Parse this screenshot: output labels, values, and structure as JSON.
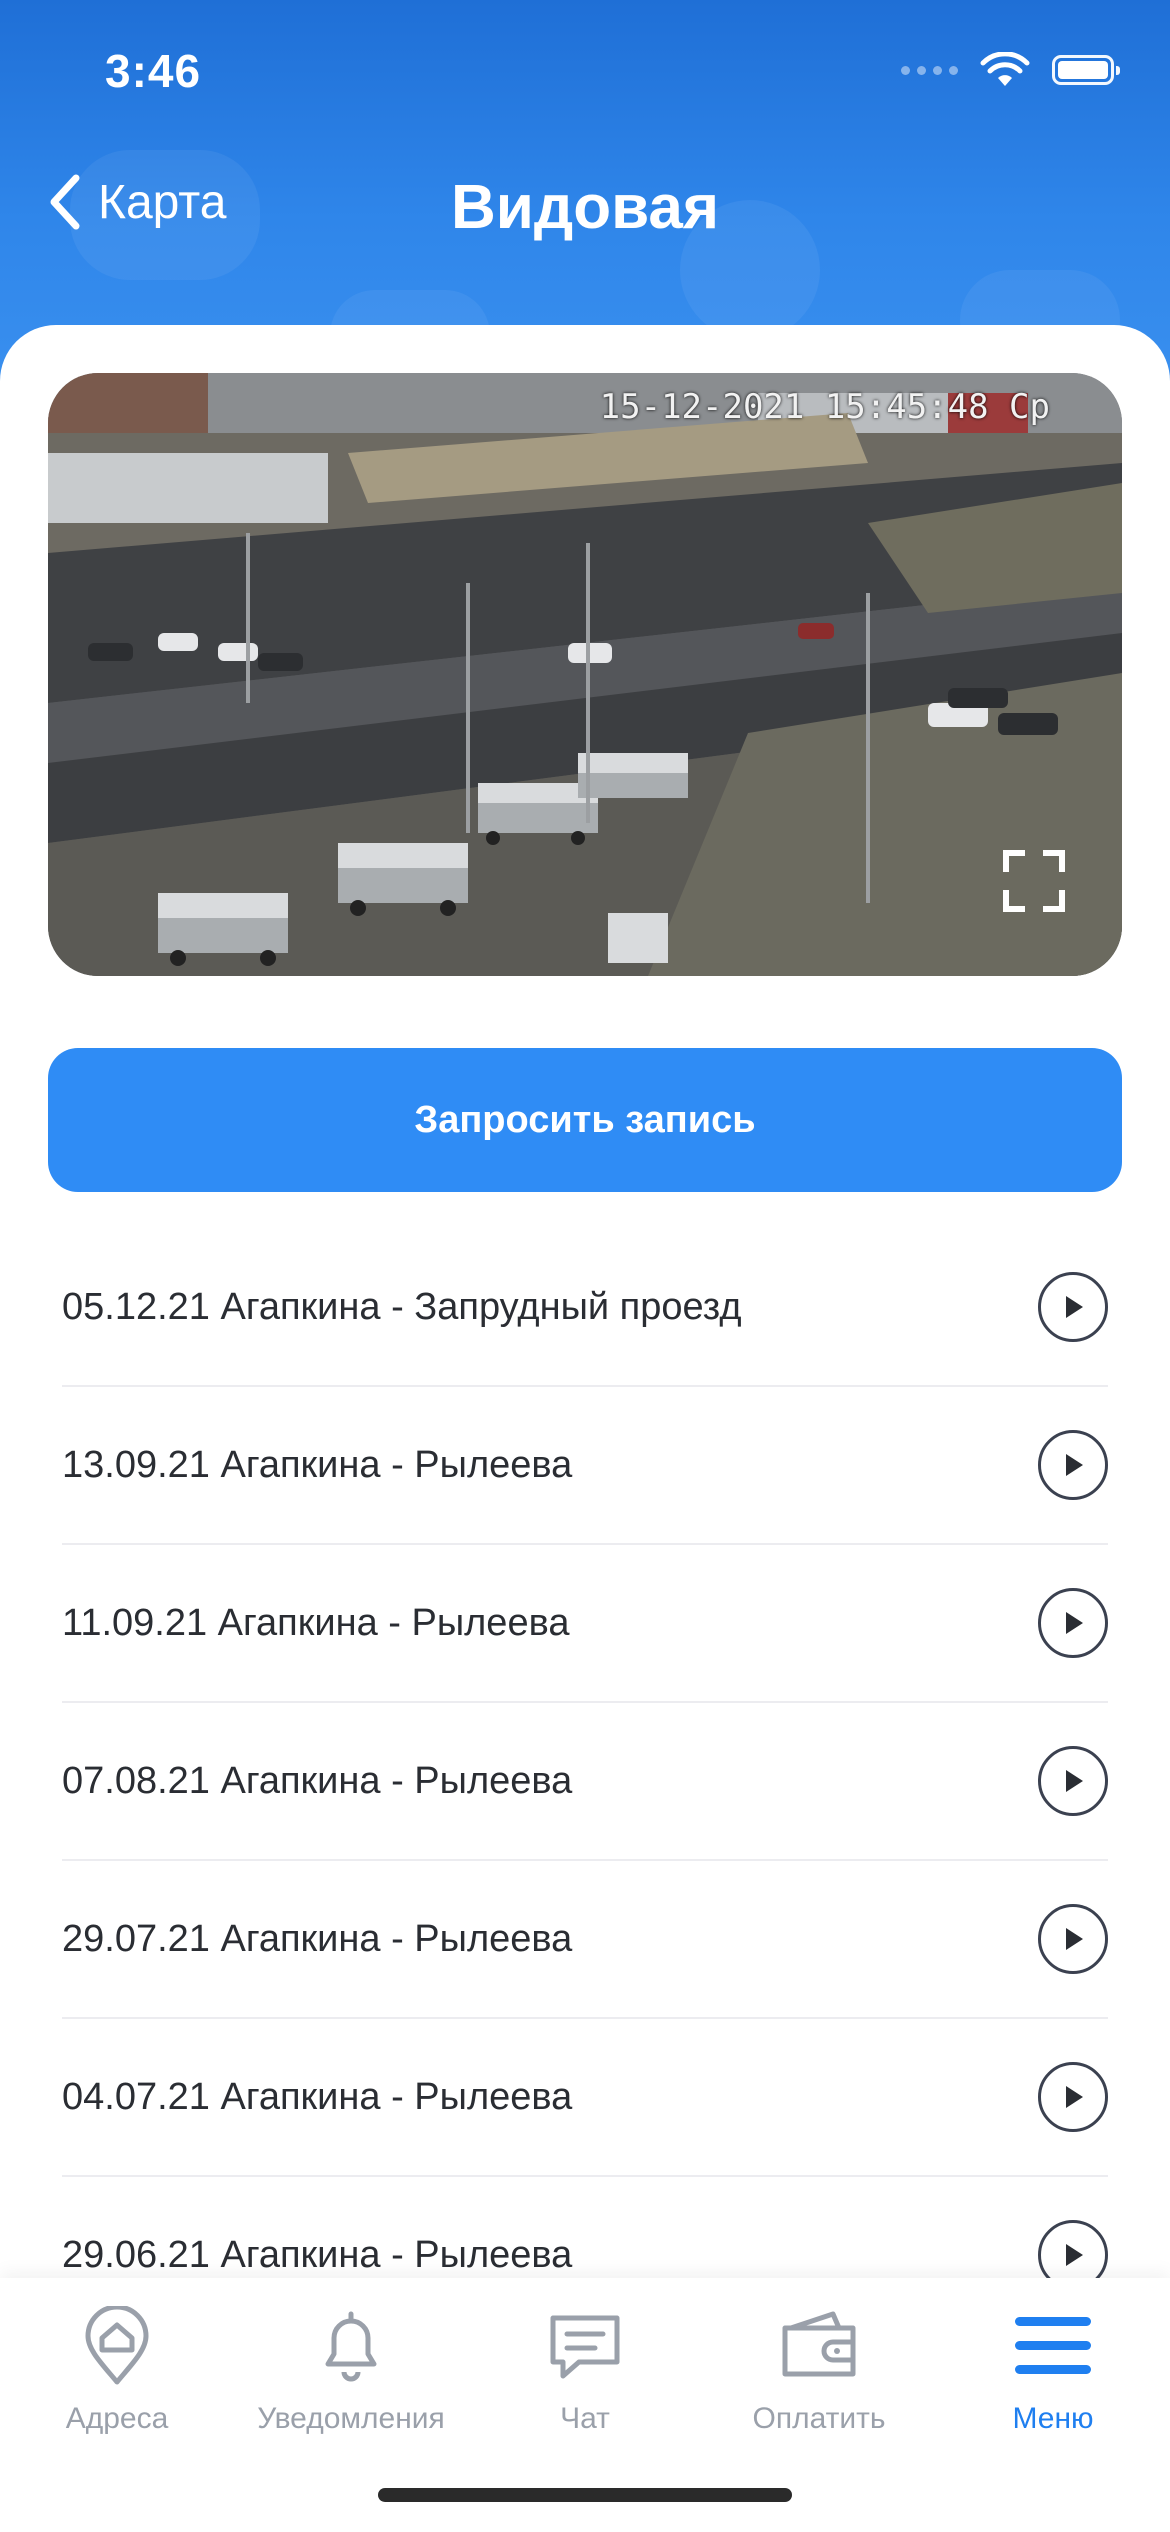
{
  "status_bar": {
    "time": "3:46"
  },
  "header": {
    "back_label": "Карта",
    "title": "Видовая"
  },
  "camera": {
    "timestamp": "15-12-2021 15:45:48 Ср"
  },
  "request_button": {
    "label": "Запросить запись"
  },
  "recordings": [
    {
      "label": "05.12.21 Агапкина - Запрудный проезд"
    },
    {
      "label": "13.09.21 Агапкина - Рылеева"
    },
    {
      "label": "11.09.21 Агапкина - Рылеева"
    },
    {
      "label": "07.08.21 Агапкина - Рылеева"
    },
    {
      "label": "29.07.21 Агапкина - Рылеева"
    },
    {
      "label": "04.07.21 Агапкина - Рылеева"
    },
    {
      "label": "29.06.21 Агапкина - Рылеева"
    }
  ],
  "tabbar": {
    "items": [
      {
        "label": "Адреса",
        "icon": "address-pin-icon",
        "active": false
      },
      {
        "label": "Уведомления",
        "icon": "bell-icon",
        "active": false
      },
      {
        "label": "Чат",
        "icon": "chat-icon",
        "active": false
      },
      {
        "label": "Оплатить",
        "icon": "wallet-icon",
        "active": false
      },
      {
        "label": "Меню",
        "icon": "menu-icon",
        "active": true
      }
    ]
  },
  "colors": {
    "header_top": "#1f6fd6",
    "accent": "#2f8cf5",
    "tab_active": "#1f7ff0",
    "tab_inactive": "#9aa0aa"
  }
}
